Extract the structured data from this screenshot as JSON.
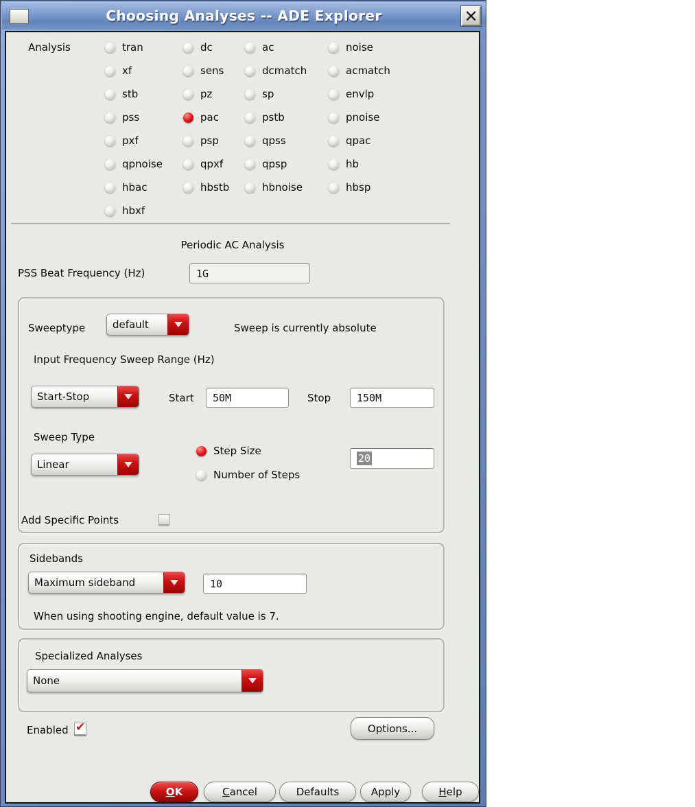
{
  "window": {
    "title": "Choosing Analyses -- ADE Explorer",
    "close_glyph": "✕"
  },
  "analysis": {
    "label": "Analysis",
    "selected": "pac",
    "options": [
      "tran",
      "dc",
      "ac",
      "noise",
      "xf",
      "sens",
      "dcmatch",
      "acmatch",
      "stb",
      "pz",
      "sp",
      "envlp",
      "pss",
      "pac",
      "pstb",
      "pnoise",
      "pxf",
      "psp",
      "qpss",
      "qpac",
      "qpnoise",
      "qpxf",
      "qpsp",
      "hb",
      "hbac",
      "hbstb",
      "hbnoise",
      "hbsp",
      "hbxf"
    ]
  },
  "section_title": "Periodic AC Analysis",
  "pss_beat_frequency": {
    "label": "PSS Beat Frequency (Hz)",
    "value": "1G"
  },
  "sweep": {
    "sweeptype_label": "Sweeptype",
    "sweeptype_value": "default",
    "status_text": "Sweep is currently absolute",
    "range_label": "Input Frequency Sweep Range (Hz)",
    "range_mode_value": "Start-Stop",
    "start_label": "Start",
    "start_value": "50M",
    "stop_label": "Stop",
    "stop_value": "150M",
    "sweep_type_label": "Sweep Type",
    "sweep_type_value": "Linear",
    "step_size_label": "Step Size",
    "step_mode_selected": "Step Size",
    "number_of_steps_label": "Number of Steps",
    "step_value": "20",
    "add_specific_points_label": "Add Specific Points",
    "add_specific_points_checked": false
  },
  "sidebands": {
    "label": "Sidebands",
    "mode_value": "Maximum sideband",
    "value": "10",
    "note": "When using shooting engine, default value is 7."
  },
  "specialized": {
    "label": "Specialized Analyses",
    "value": "None"
  },
  "enabled": {
    "label": "Enabled",
    "checked": true
  },
  "options_button": "Options...",
  "footer_buttons": [
    {
      "label": "OK",
      "mnemonic": 0,
      "primary": true
    },
    {
      "label": "Cancel",
      "mnemonic": 0,
      "primary": false
    },
    {
      "label": "Defaults",
      "mnemonic": -1,
      "primary": false
    },
    {
      "label": "Apply",
      "mnemonic": -1,
      "primary": false
    },
    {
      "label": "Help",
      "mnemonic": 0,
      "primary": false
    }
  ],
  "colors": {
    "accent_red": "#cc1212",
    "titlebar_blue": "#7292c4",
    "dialog_bg": "#e9e9e6"
  }
}
